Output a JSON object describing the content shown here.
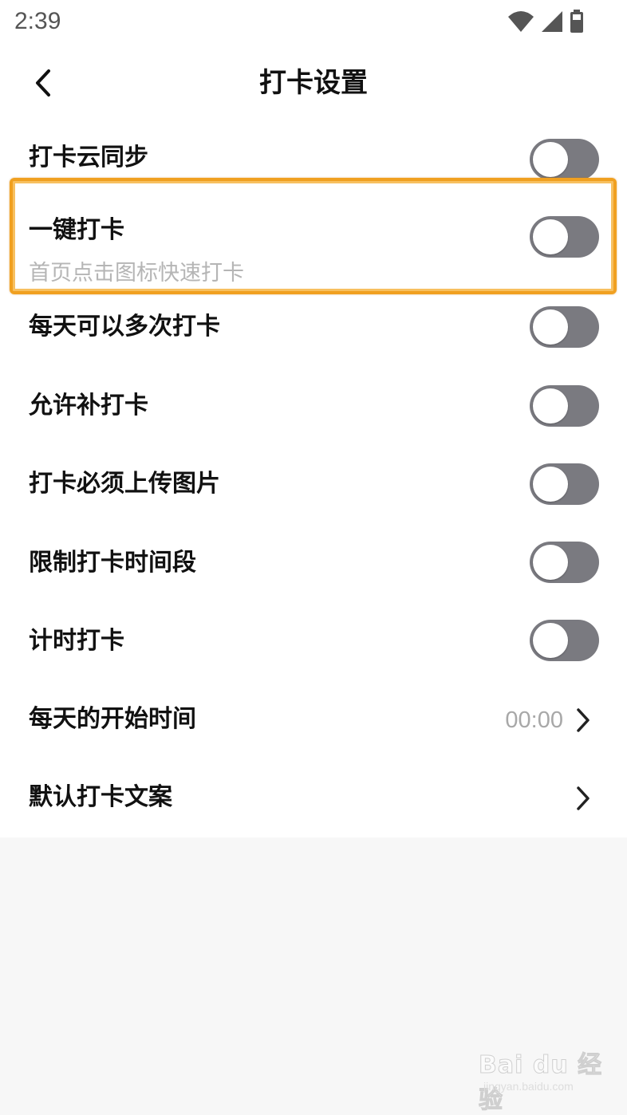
{
  "status_bar": {
    "time": "2:39",
    "icons": [
      "wifi-icon",
      "signal-icon",
      "battery-icon"
    ]
  },
  "header": {
    "title": "打卡设置",
    "back_icon": "chevron-left-icon"
  },
  "settings": [
    {
      "label": "打卡云同步",
      "type": "toggle",
      "on": false
    },
    {
      "label": "一键打卡",
      "sublabel": "首页点击图标快速打卡",
      "type": "toggle",
      "on": false,
      "highlighted": true
    },
    {
      "label": "每天可以多次打卡",
      "type": "toggle",
      "on": false
    },
    {
      "label": "允许补打卡",
      "type": "toggle",
      "on": false
    },
    {
      "label": "打卡必须上传图片",
      "type": "toggle",
      "on": false
    },
    {
      "label": "限制打卡时间段",
      "type": "toggle",
      "on": false
    },
    {
      "label": "计时打卡",
      "type": "toggle",
      "on": false
    },
    {
      "label": "每天的开始时间",
      "type": "link",
      "value": "00:00"
    },
    {
      "label": "默认打卡文案",
      "type": "link"
    }
  ],
  "colors": {
    "toggle_off": "#7a7a80",
    "highlight": "#f0a020",
    "page_bg": "#f7f7f7",
    "sublabel": "#b5b5b5",
    "value": "#a8a8a8"
  },
  "watermark": {
    "logo": "Bai du 经验",
    "url": "jingyan.baidu.com"
  }
}
